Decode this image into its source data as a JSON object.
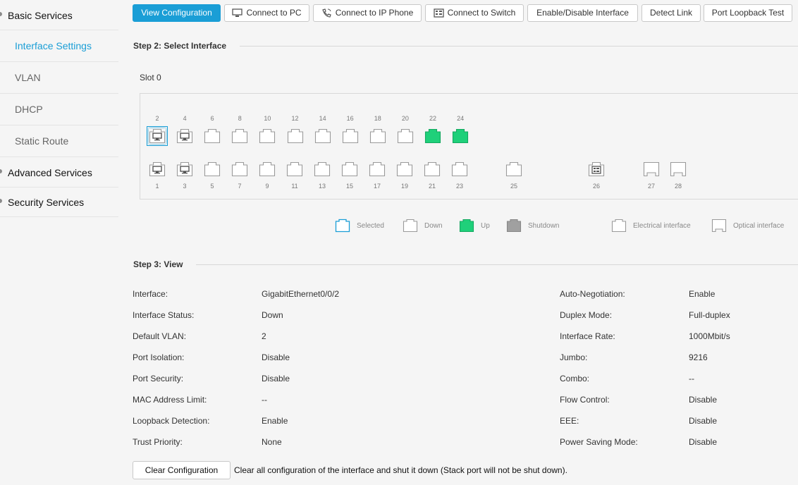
{
  "sidebar": {
    "basic": "Basic Services",
    "items": [
      "Interface Settings",
      "VLAN",
      "DHCP",
      "Static Route"
    ],
    "advanced": "Advanced Services",
    "security": "Security Services"
  },
  "toolbar": {
    "view": "View Configuration",
    "pc": "Connect to PC",
    "phone": "Connect to IP Phone",
    "switch": "Connect to Switch",
    "enable": "Enable/Disable Interface",
    "detect": "Detect Link",
    "loopback": "Port Loopback Test"
  },
  "step2": {
    "title": "Step 2: Select Interface",
    "slot": "Slot 0"
  },
  "ports": {
    "top": [
      {
        "num": "2",
        "state": "selected",
        "icon": "pc"
      },
      {
        "num": "4",
        "state": "down",
        "icon": "pc"
      },
      {
        "num": "6",
        "state": "down",
        "icon": ""
      },
      {
        "num": "8",
        "state": "down",
        "icon": ""
      },
      {
        "num": "10",
        "state": "down",
        "icon": ""
      },
      {
        "num": "12",
        "state": "down",
        "icon": ""
      },
      {
        "num": "14",
        "state": "down",
        "icon": ""
      },
      {
        "num": "16",
        "state": "down",
        "icon": ""
      },
      {
        "num": "18",
        "state": "down",
        "icon": ""
      },
      {
        "num": "20",
        "state": "down",
        "icon": ""
      },
      {
        "num": "22",
        "state": "up",
        "icon": ""
      },
      {
        "num": "24",
        "state": "up",
        "icon": ""
      }
    ],
    "bottom": [
      {
        "num": "1",
        "state": "down",
        "icon": "pc"
      },
      {
        "num": "3",
        "state": "down",
        "icon": "pc"
      },
      {
        "num": "5",
        "state": "down",
        "icon": ""
      },
      {
        "num": "7",
        "state": "down",
        "icon": ""
      },
      {
        "num": "9",
        "state": "down",
        "icon": ""
      },
      {
        "num": "11",
        "state": "down",
        "icon": ""
      },
      {
        "num": "13",
        "state": "down",
        "icon": ""
      },
      {
        "num": "15",
        "state": "down",
        "icon": ""
      },
      {
        "num": "17",
        "state": "down",
        "icon": ""
      },
      {
        "num": "19",
        "state": "down",
        "icon": ""
      },
      {
        "num": "21",
        "state": "down",
        "icon": ""
      },
      {
        "num": "23",
        "state": "down",
        "icon": ""
      },
      {
        "num": "25",
        "state": "down",
        "icon": ""
      },
      {
        "num": "26",
        "state": "down",
        "icon": "switch"
      },
      {
        "num": "27",
        "state": "down",
        "icon": "optical"
      },
      {
        "num": "28",
        "state": "down",
        "icon": "optical"
      }
    ]
  },
  "legend": {
    "selected": "Selected",
    "down": "Down",
    "up": "Up",
    "shutdown": "Shutdown",
    "electrical": "Electrical interface",
    "optical": "Optical interface"
  },
  "step3": {
    "title": "Step 3: View"
  },
  "info": {
    "left": [
      {
        "label": "Interface:",
        "value": "GigabitEthernet0/0/2"
      },
      {
        "label": "Interface Status:",
        "value": "Down"
      },
      {
        "label": "Default VLAN:",
        "value": "2"
      },
      {
        "label": "Port Isolation:",
        "value": "Disable"
      },
      {
        "label": "Port Security:",
        "value": "Disable"
      },
      {
        "label": "MAC Address Limit:",
        "value": "--"
      },
      {
        "label": "Loopback Detection:",
        "value": "Enable"
      },
      {
        "label": "Trust Priority:",
        "value": "None"
      }
    ],
    "right": [
      {
        "label": "Auto-Negotiation:",
        "value": "Enable"
      },
      {
        "label": "Duplex Mode:",
        "value": "Full-duplex"
      },
      {
        "label": "Interface Rate:",
        "value": "1000Mbit/s"
      },
      {
        "label": "Jumbo:",
        "value": "9216"
      },
      {
        "label": "Combo:",
        "value": "--"
      },
      {
        "label": "Flow Control:",
        "value": "Disable"
      },
      {
        "label": "EEE:",
        "value": "Disable"
      },
      {
        "label": "Power Saving Mode:",
        "value": "Disable"
      }
    ]
  },
  "clear": {
    "button": "Clear Configuration",
    "note": "Clear all configuration of the interface and shut it down (Stack port will not be shut down)."
  },
  "colors": {
    "accent": "#1a9ed6",
    "up": "#1fd07a",
    "down_stroke": "#9a9a9a",
    "shutdown": "#a0a0a0"
  }
}
